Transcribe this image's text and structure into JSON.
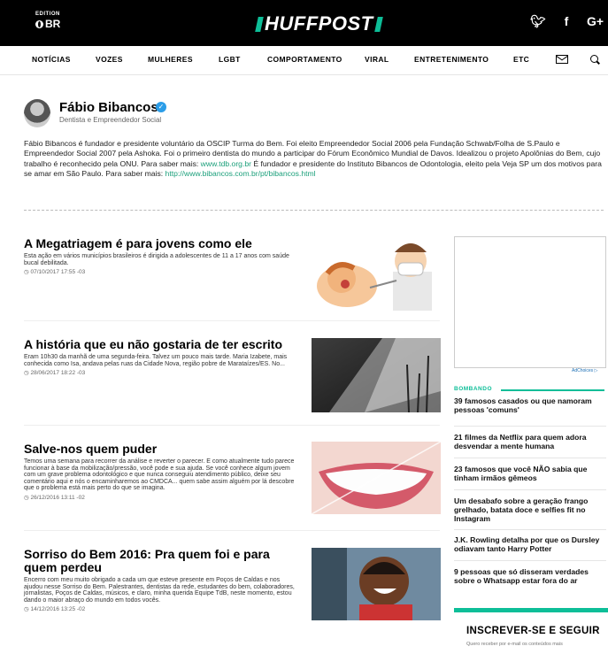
{
  "header": {
    "edition_label": "EDITION",
    "edition_code": "BR",
    "logo_text": "HUFFPOST",
    "social": [
      {
        "icon": "twitter-icon",
        "glyph": "❧"
      },
      {
        "icon": "facebook-icon",
        "glyph": "f"
      },
      {
        "icon": "google-plus-icon",
        "glyph": "G+"
      }
    ]
  },
  "nav": {
    "items": [
      "NOTÍCIAS",
      "VOZES",
      "MULHERES",
      "LGBT",
      "COMPORTAMENTO",
      "VIRAL",
      "ENTRETENIMENTO",
      "ETC"
    ],
    "icons": [
      "mail-icon",
      "search-icon"
    ]
  },
  "author": {
    "name": "Fábio Bibancos",
    "title": "Dentista e Empreendedor Social",
    "bio_part1": "Fábio Bibancos é fundador e presidente voluntário da OSCIP Turma do Bem. Foi eleito Empreendedor Social 2006 pela Fundação Schwab/Folha de S.Paulo e Empreendedor Social 2007 pela Ashoka. Foi o primeiro dentista do mundo a participar do Fórum Econômico Mundial de Davos. Idealizou o projeto Apolônias do Bem, cujo trabalho é reconhecido pela ONU. Para saber mais: ",
    "bio_link1": "www.tdb.org.br",
    "bio_part2": " É fundador e presidente do Instituto Bibancos de Odontologia, eleito pela Veja SP um dos motivos para se amar em São Paulo. Para saber mais: ",
    "bio_link2": "http://www.bibancos.com.br/pt/bibancos.html"
  },
  "articles": [
    {
      "title": "A Megatriagem é para jovens como ele",
      "summary": "Esta ação em vários municípios brasileiros é dirigida a adolescentes de 11 a 17 anos com saúde bucal debilitada.",
      "timestamp": "07/10/2017 17:55 -03"
    },
    {
      "title": "A história que eu não gostaria de ter escrito",
      "summary": "Eram 10h30 da manhã de uma segunda-feira. Talvez um pouco mais tarde. Maria Izabete, mais conhecida como Isa, andava pelas ruas da Cidade Nova, região pobre de Marataízes/ES. No...",
      "timestamp": "28/06/2017 18:22 -03"
    },
    {
      "title": "Salve-nos quem puder",
      "summary": "Temos uma semana para recorrer da análise e reverter o parecer. E como atualmente tudo parece funcionar à base da mobilização/pressão, você pode e sua ajuda. Se você conhece algum jovem com um grave problema odontológico e que nunca conseguiu atendimento público, deixe seu comentário aqui e nós o encaminharemos ao CMDCA... quem sabe assim alguém por lá descobre que o problema está mais perto do que se imagina.",
      "timestamp": "26/12/2016 13:11 -02"
    },
    {
      "title": "Sorriso do Bem 2016: Pra quem foi e para quem perdeu",
      "summary": "Encerro com meu muito obrigado a cada um que esteve presente em Poços de Caldas e nos ajudou nesse Sorriso do Bem. Palestrantes, dentistas da rede, estudantes do bem, colaboradores, jornalistas, Poços de Caldas, músicos, e claro, minha querida Equipe TdB, neste momento, estou dando o maior abraço do mundo em todos vocês.",
      "timestamp": "14/12/2016 13:25 -02"
    }
  ],
  "sidebar": {
    "ad_choices": "AdChoices",
    "trending_label": "BOMBANDO",
    "trending": [
      "39 famosos casados ou que namoram pessoas 'comuns'",
      "21 filmes da Netflix para quem adora desvendar a mente humana",
      "23 famosos que você NÃO sabia que tinham irmãos gêmeos",
      "Um desabafo sobre a geração frango grelhado, batata doce e selfies fit no Instagram",
      "J.K. Rowling detalha por que os Dursley odiavam tanto Harry Potter",
      "9 pessoas que só disseram verdades sobre o Whatsapp estar fora do ar"
    ],
    "subscribe_title": "INSCREVER-SE E SEGUIR",
    "subscribe_text": "Quero receber por e-mail os conteúdos mais"
  },
  "colors": {
    "accent": "#0dbe98",
    "link": "#1a9f7a",
    "verified": "#2b9de8"
  }
}
